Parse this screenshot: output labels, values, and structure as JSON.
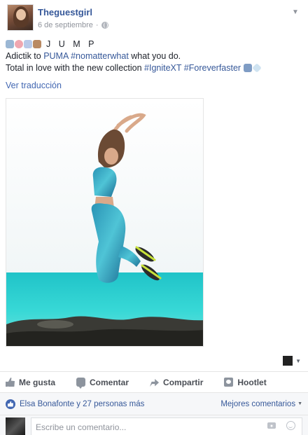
{
  "post": {
    "author": "Theguestgirl",
    "date": "6 de septiembre",
    "privacy_icon": "globe-icon",
    "line1_text": "J U M P",
    "line2_prefix": "Adictik to ",
    "line2_brand": "PUMA",
    "line2_hashtag": "#nomatterwhat",
    "line2_suffix": " what you do.",
    "line3_prefix": "Total in love with the new collection ",
    "line3_tag1": "#IgniteXT",
    "line3_tag2": "#Foreverfaster",
    "translate_link": "Ver traducción",
    "photo_icon": "jumping-woman-photo"
  },
  "actions": {
    "like": "Me gusta",
    "comment": "Comentar",
    "share": "Compartir",
    "hootlet": "Hootlet"
  },
  "likes": {
    "text": "Elsa Bonafonte y 27 personas más",
    "top_comments": "Mejores comentarios"
  },
  "comment_box": {
    "placeholder": "Escribe un comentario..."
  },
  "colors": {
    "link": "#365899",
    "accent": "#4267b2",
    "sea": "#2fc9c9"
  }
}
